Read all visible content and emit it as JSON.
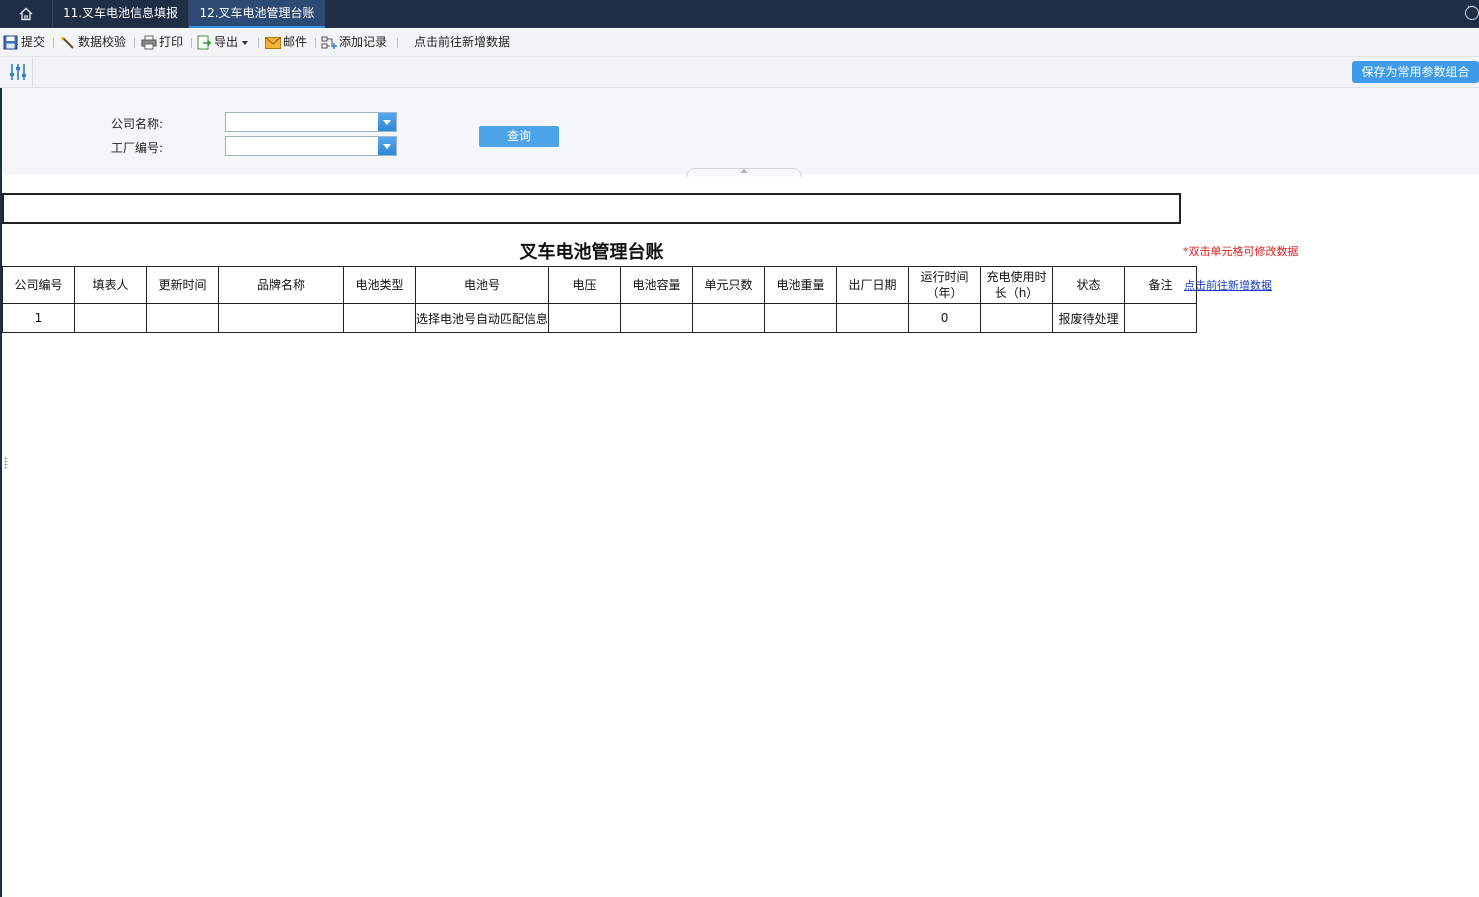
{
  "tabs": [
    {
      "label": "11.叉车电池信息填报"
    },
    {
      "label": "12.叉车电池管理台账"
    }
  ],
  "toolbar": {
    "submit": "提交",
    "validate": "数据校验",
    "print": "打印",
    "export": "导出",
    "mail": "邮件",
    "add_record": "添加记录",
    "goto_add": "点击前往新增数据"
  },
  "filter_bar": {
    "save_combo": "保存为常用参数组合"
  },
  "params": {
    "company_label": "公司名称:",
    "factory_label": "工厂编号:",
    "company_value": "",
    "factory_value": "",
    "query": "查询"
  },
  "report": {
    "title": "叉车电池管理台账",
    "note": "*双击单元格可修改数据",
    "link": "点击前往新增数据",
    "columns": [
      "公司编号",
      "填表人",
      "更新时间",
      "品牌名称",
      "电池类型",
      "电池号",
      "电压",
      "电池容量",
      "单元只数",
      "电池重量",
      "出厂日期",
      "运行时间（年）",
      "充电使用时长（h）",
      "状态",
      "备注"
    ],
    "rows": [
      [
        "1",
        "",
        "",
        "",
        "",
        "选择电池号自动匹配信息",
        "",
        "",
        "",
        "",
        "",
        "0",
        "",
        "报废待处理",
        ""
      ]
    ]
  },
  "colors": {
    "tabbar": "#1f2d45",
    "accent": "#3d9be9",
    "note": "#e02020",
    "link": "#1a3cc8"
  }
}
